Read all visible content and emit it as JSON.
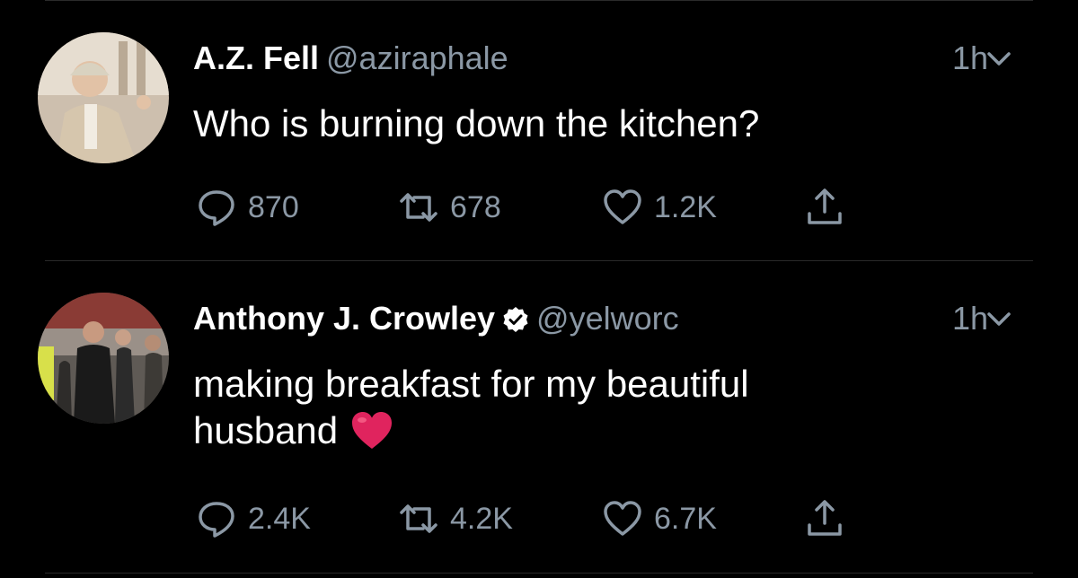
{
  "tweets": [
    {
      "name": "A.Z. Fell",
      "handle": "@aziraphale",
      "verified": false,
      "time": "1h",
      "text_lines": [
        "Who is burning down the kitchen?"
      ],
      "replies": "870",
      "retweets": "678",
      "likes": "1.2K"
    },
    {
      "name": "Anthony J. Crowley",
      "handle": "@yelworc",
      "verified": true,
      "time": "1h",
      "text_lines": [
        "making breakfast for my beautiful",
        "husband"
      ],
      "replies": "2.4K",
      "retweets": "4.2K",
      "likes": "6.7K"
    }
  ],
  "colors": {
    "background": "#000000",
    "text": "#ffffff",
    "muted": "#8b98a5",
    "heart_emoji": "#e0245e"
  },
  "icons": [
    "reply-icon",
    "retweet-icon",
    "like-icon",
    "share-icon",
    "chevron-down-icon",
    "verified-badge-icon",
    "red-heart-emoji"
  ]
}
